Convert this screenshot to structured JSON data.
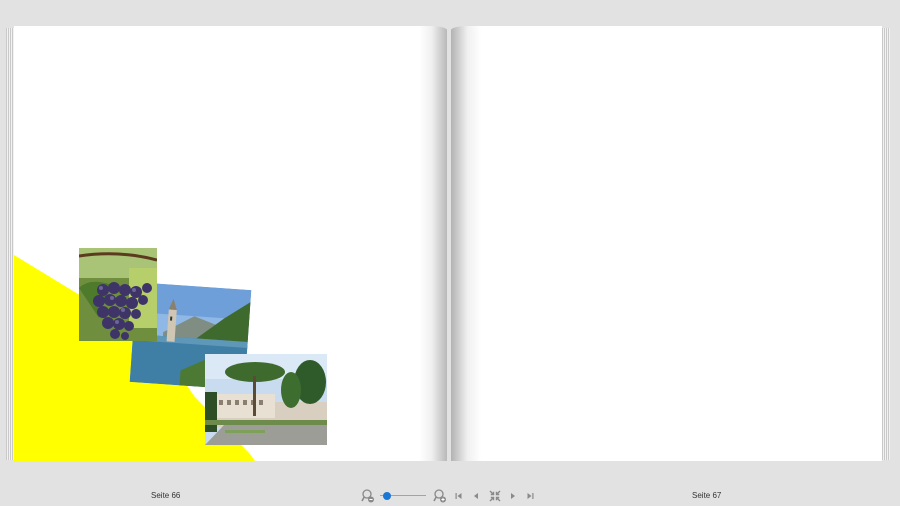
{
  "book": {
    "left_page_label": "Seite 66",
    "right_page_label": "Seite 67"
  },
  "zoom": {
    "level": 0.15
  },
  "colors": {
    "background": "#e2e2e2",
    "page": "#ffffff",
    "yellow_shape": "#ffff00",
    "slider_accent": "#1a78d4",
    "icon": "#8a8a8a"
  },
  "icons": {
    "zoom_out": "zoom-out-icon",
    "zoom_in": "zoom-in-icon",
    "first_page": "first-page-icon",
    "previous_page": "previous-page-icon",
    "fit_page": "fit-page-icon",
    "next_page": "next-page-icon",
    "last_page": "last-page-icon"
  }
}
